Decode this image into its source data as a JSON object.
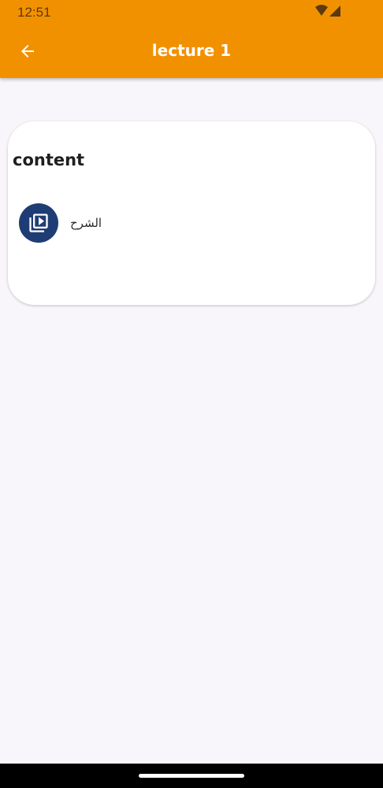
{
  "status_bar": {
    "time": "12:51",
    "icons": [
      "wifi-icon",
      "signal-icon"
    ]
  },
  "app_bar": {
    "title": "lecture 1",
    "back_icon": "arrow-left-icon",
    "background_color": "#f29100"
  },
  "content_card": {
    "heading": "content",
    "items": [
      {
        "label": "الشرح",
        "icon": "video-library-icon",
        "icon_background": "#1f3d75"
      }
    ]
  }
}
